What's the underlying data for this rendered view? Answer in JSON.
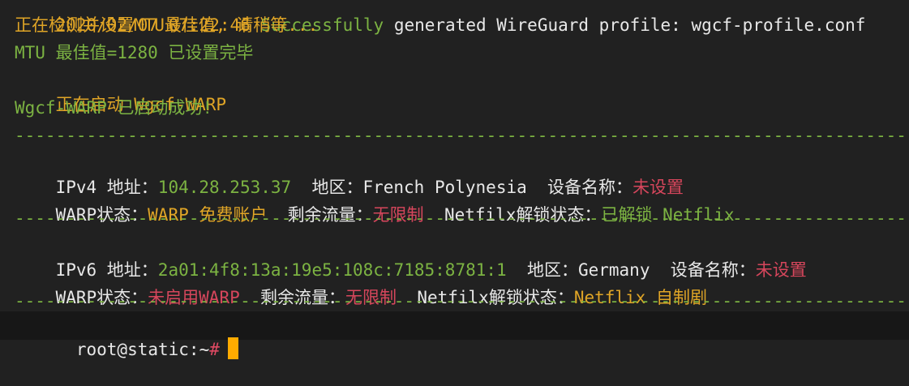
{
  "colors": {
    "green": "#7cb342",
    "yellow": "#e0a526",
    "red": "#d6465c",
    "white": "#e8e8e8",
    "cursor": "#ffab00",
    "prompt_hash": "#e04a63"
  },
  "lines": {
    "cut_top": [
      {
        "text": "2020/02/07 07:22:46 ",
        "color": "#e0a526"
      },
      {
        "text": "Successfully",
        "color": "#7cb342"
      },
      {
        "text": " generated WireGuard profile: wgcf-profile.conf",
        "color": "#e8e8e8"
      }
    ],
    "detecting": "正在检测并设置MTU最佳值, 请稍等...",
    "mtu_done": "MTU 最佳值=1280 已设置完毕",
    "starting_prefix": "正在启动 ",
    "starting_name": "Wgcf-WARP",
    "started": "Wgcf-WARP 已启动成功!",
    "divider": "--------------------------------------------------------------------------------------------------------------------------------------------"
  },
  "ipv4": {
    "addr_label": "IPv4 地址：",
    "addr_value": "104.28.253.37",
    "region_label": "  地区：",
    "region_value": "French Polynesia",
    "device_label": "  设备名称：",
    "device_value": "未设置",
    "warp_label": "WARP状态：",
    "warp_value": "WARP 免费账户",
    "traffic_label": "  剩余流量：",
    "traffic_value": "无限制",
    "netflix_label": "  Netfilx解锁状态：",
    "netflix_value": "已解锁 Netflix"
  },
  "ipv6": {
    "addr_label": "IPv6 地址：",
    "addr_value": "2a01:4f8:13a:19e5:108c:7185:8781:1",
    "region_label": "  地区：",
    "region_value": "Germany",
    "device_label": "  设备名称：",
    "device_value": "未设置",
    "warp_label": "WARP状态：",
    "warp_value": "未启用WARP",
    "traffic_label": "  剩余流量：",
    "traffic_value": "无限制",
    "netflix_label": "  Netfilx解锁状态：",
    "netflix_value": "Netflix 自制剧"
  },
  "prompt": {
    "user_host": "root@static:~",
    "symbol": "#"
  }
}
